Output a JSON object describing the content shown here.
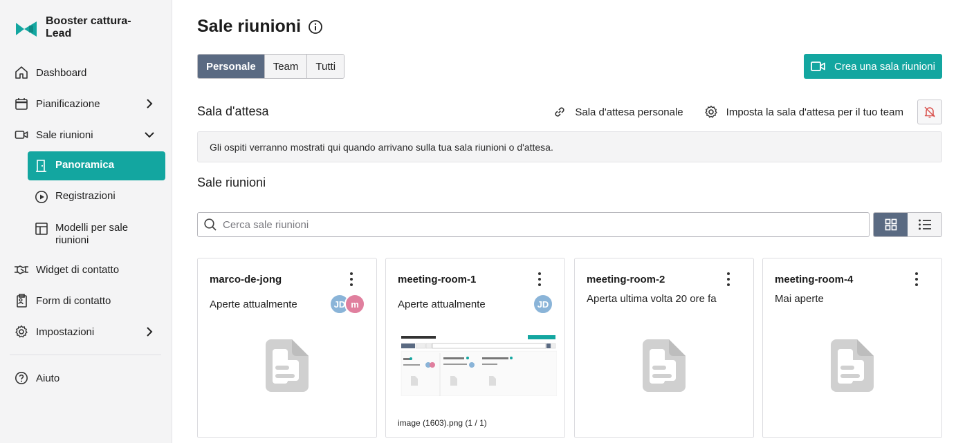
{
  "brand": {
    "name": "Booster cattura-Lead",
    "color": "#13a6a0"
  },
  "sidebar": {
    "items": [
      {
        "label": "Dashboard",
        "icon": "home-icon"
      },
      {
        "label": "Pianificazione",
        "icon": "calendar-icon",
        "expandable": true
      },
      {
        "label": "Sale riunioni",
        "icon": "video-icon",
        "expanded": true
      },
      {
        "label": "Widget di contatto",
        "icon": "handshake-icon"
      },
      {
        "label": "Form di contatto",
        "icon": "form-icon"
      },
      {
        "label": "Impostazioni",
        "icon": "gear-icon",
        "expandable": true
      },
      {
        "label": "Aiuto",
        "icon": "help-icon"
      }
    ],
    "subitems": [
      {
        "label": "Panoramica",
        "icon": "door-icon",
        "active": true
      },
      {
        "label": "Registrazioni",
        "icon": "play-icon"
      },
      {
        "label": "Modelli per sale riunioni",
        "icon": "template-icon"
      }
    ]
  },
  "page": {
    "title": "Sale riunioni",
    "tabs": [
      "Personale",
      "Team",
      "Tutti"
    ],
    "active_tab": "Personale",
    "create_button": "Crea una sala riunioni"
  },
  "waiting_room": {
    "heading": "Sala d'attesa",
    "personal_link": "Sala d'attesa personale",
    "team_setup": "Imposta la sala d'attesa per il tuo team",
    "notice": "Gli ospiti verranno mostrati qui quando arrivano sulla tua sala riunioni o d'attesa."
  },
  "rooms": {
    "heading": "Sale riunioni",
    "search_placeholder": "Cerca sale riunioni",
    "view": "grid",
    "cards": [
      {
        "name": "marco-de-jong",
        "status": "Aperte attualmente",
        "avatars": [
          {
            "initials": "JD",
            "color": "#8ab4d8"
          },
          {
            "initials": "m",
            "color": "#e07f9e"
          }
        ]
      },
      {
        "name": "meeting-room-1",
        "status": "Aperte attualmente",
        "avatars": [
          {
            "initials": "JD",
            "color": "#8ab4d8"
          }
        ],
        "thumbnail_caption": "image (1603).png (1 / 1)"
      },
      {
        "name": "meeting-room-2",
        "status": "Aperta ultima volta 20 ore fa",
        "avatars": []
      },
      {
        "name": "meeting-room-4",
        "status": "Mai aperte",
        "avatars": []
      }
    ]
  }
}
